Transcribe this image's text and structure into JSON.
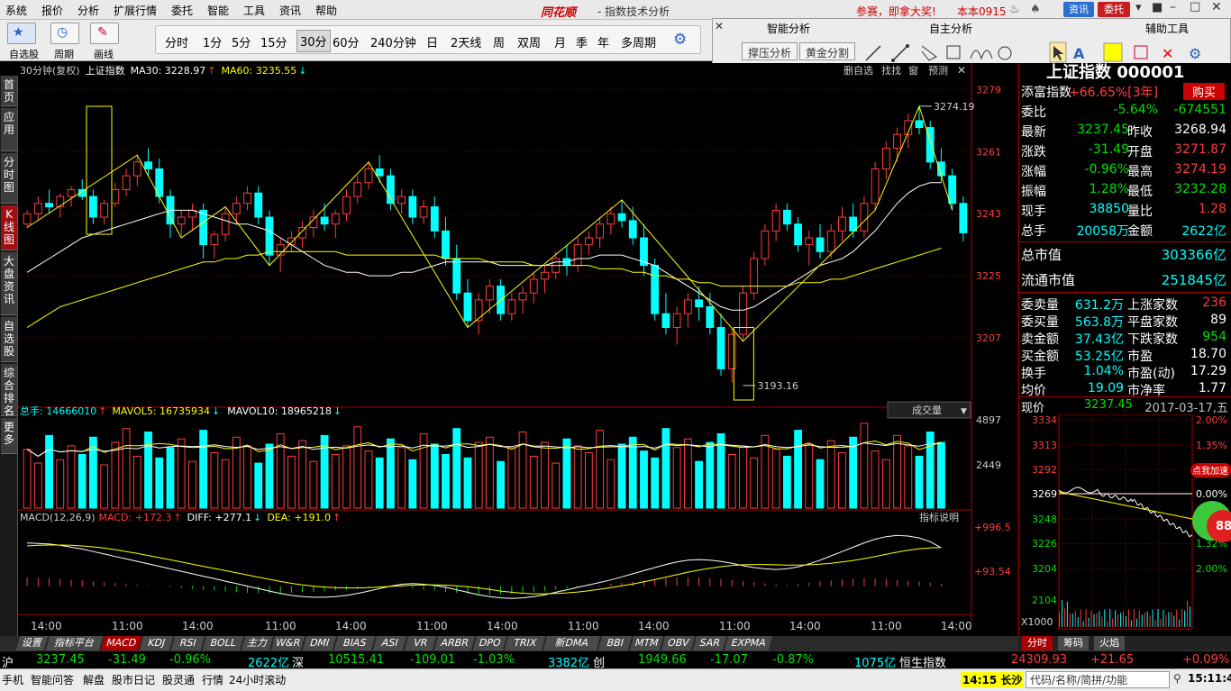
{
  "menu": [
    "系统",
    "报价",
    "分析",
    "扩展行情",
    "委托",
    "智能",
    "工具",
    "资讯",
    "帮助"
  ],
  "app": {
    "logo": "同花顺",
    "title": "- 指数技术分析",
    "promo": "参赛，即拿大奖!",
    "user": "本本0915",
    "btn_info": "资讯",
    "btn_trade": "委托"
  },
  "toolbar": {
    "labels": [
      "自选股",
      "周期",
      "画线"
    ]
  },
  "periods": [
    "分时",
    "1分",
    "5分",
    "15分",
    "30分",
    "60分",
    "240分钟",
    "日",
    "2天线",
    "周",
    "双周",
    "月",
    "季",
    "年",
    "多周期"
  ],
  "active_period": "30分",
  "panel": {
    "headers": [
      "智能分析",
      "自主分析",
      "辅助工具"
    ],
    "buttons": [
      "撑压分析",
      "黄金分割"
    ]
  },
  "left_tabs": [
    "首页",
    "应用",
    "分时图",
    "K线图",
    "大盘资讯",
    "自选股",
    "综合排名",
    "更多"
  ],
  "chart_header": {
    "period": "30分钟(复权)",
    "name": "上证指数",
    "ma30": "MA30: 3228.97",
    "ma60": "MA60: 3235.55"
  },
  "vol_header": {
    "total": "总手: 14666010",
    "mavol5": "MAVOL5: 16735934",
    "mavol10": "MAVOL10: 18965218",
    "dropdown": "成交量"
  },
  "macd_header": {
    "macd": "MACD(12,26,9)",
    "macd_val": "MACD: +172.3",
    "diff": "DIFF: +277.1",
    "dea": "DEA: +191.0",
    "help": "指标说明"
  },
  "chart_buttons": [
    "删自选",
    "找找",
    "窗",
    "预测"
  ],
  "annotations": {
    "high": "3274.19",
    "low": "3193.16"
  },
  "price_axis": [
    "3279",
    "3261",
    "3243",
    "3225",
    "3207"
  ],
  "vol_axis": [
    "4897",
    "2449"
  ],
  "macd_axis": [
    "+996.5",
    "+93.54"
  ],
  "time_axis": [
    "14:00",
    "11:00",
    "14:00",
    "11:00",
    "14:00",
    "11:00",
    "14:00",
    "11:00",
    "14:00",
    "11:00",
    "14:00",
    "11:00",
    "14:00"
  ],
  "chart_data": {
    "type": "candlestick",
    "price_range": [
      3190,
      3282
    ],
    "ohlc": [
      [
        3240,
        3244,
        3239,
        3243
      ],
      [
        3243,
        3248,
        3241,
        3246
      ],
      [
        3246,
        3250,
        3243,
        3245
      ],
      [
        3245,
        3249,
        3242,
        3248
      ],
      [
        3248,
        3251,
        3245,
        3250
      ],
      [
        3250,
        3253,
        3247,
        3248
      ],
      [
        3248,
        3250,
        3240,
        3242
      ],
      [
        3242,
        3247,
        3240,
        3246
      ],
      [
        3246,
        3252,
        3245,
        3250
      ],
      [
        3250,
        3256,
        3248,
        3254
      ],
      [
        3254,
        3260,
        3251,
        3258
      ],
      [
        3258,
        3262,
        3254,
        3256
      ],
      [
        3256,
        3259,
        3246,
        3248
      ],
      [
        3248,
        3250,
        3236,
        3240
      ],
      [
        3240,
        3244,
        3236,
        3242
      ],
      [
        3242,
        3246,
        3238,
        3244
      ],
      [
        3244,
        3246,
        3230,
        3234
      ],
      [
        3234,
        3238,
        3230,
        3237
      ],
      [
        3237,
        3245,
        3235,
        3243
      ],
      [
        3243,
        3248,
        3240,
        3246
      ],
      [
        3246,
        3251,
        3244,
        3249
      ],
      [
        3249,
        3251,
        3240,
        3242
      ],
      [
        3242,
        3244,
        3228,
        3231
      ],
      [
        3231,
        3236,
        3226,
        3234
      ],
      [
        3234,
        3238,
        3232,
        3236
      ],
      [
        3236,
        3241,
        3233,
        3239
      ],
      [
        3239,
        3244,
        3236,
        3242
      ],
      [
        3242,
        3246,
        3238,
        3240
      ],
      [
        3240,
        3244,
        3236,
        3243
      ],
      [
        3243,
        3250,
        3241,
        3248
      ],
      [
        3248,
        3254,
        3246,
        3252
      ],
      [
        3252,
        3258,
        3250,
        3256
      ],
      [
        3256,
        3260,
        3252,
        3254
      ],
      [
        3254,
        3256,
        3244,
        3246
      ],
      [
        3246,
        3250,
        3243,
        3248
      ],
      [
        3248,
        3250,
        3240,
        3242
      ],
      [
        3242,
        3247,
        3240,
        3245
      ],
      [
        3245,
        3248,
        3236,
        3238
      ],
      [
        3238,
        3242,
        3228,
        3230
      ],
      [
        3230,
        3234,
        3218,
        3220
      ],
      [
        3220,
        3224,
        3210,
        3212
      ],
      [
        3212,
        3220,
        3208,
        3218
      ],
      [
        3218,
        3224,
        3214,
        3222
      ],
      [
        3222,
        3224,
        3212,
        3214
      ],
      [
        3214,
        3220,
        3212,
        3218
      ],
      [
        3218,
        3222,
        3214,
        3220
      ],
      [
        3220,
        3226,
        3217,
        3224
      ],
      [
        3224,
        3228,
        3220,
        3226
      ],
      [
        3226,
        3232,
        3224,
        3230
      ],
      [
        3230,
        3234,
        3225,
        3228
      ],
      [
        3228,
        3236,
        3226,
        3234
      ],
      [
        3234,
        3238,
        3231,
        3236
      ],
      [
        3236,
        3242,
        3233,
        3240
      ],
      [
        3240,
        3245,
        3237,
        3243
      ],
      [
        3243,
        3247,
        3239,
        3241
      ],
      [
        3241,
        3245,
        3234,
        3236
      ],
      [
        3236,
        3240,
        3225,
        3228
      ],
      [
        3228,
        3230,
        3212,
        3214
      ],
      [
        3214,
        3220,
        3208,
        3210
      ],
      [
        3210,
        3216,
        3205,
        3214
      ],
      [
        3214,
        3220,
        3210,
        3218
      ],
      [
        3218,
        3222,
        3212,
        3216
      ],
      [
        3216,
        3220,
        3208,
        3210
      ],
      [
        3210,
        3214,
        3196,
        3198
      ],
      [
        3198,
        3210,
        3194,
        3208
      ],
      [
        3208,
        3222,
        3206,
        3220
      ],
      [
        3220,
        3232,
        3218,
        3230
      ],
      [
        3230,
        3240,
        3228,
        3238
      ],
      [
        3238,
        3246,
        3235,
        3244
      ],
      [
        3244,
        3246,
        3238,
        3240
      ],
      [
        3240,
        3242,
        3232,
        3234
      ],
      [
        3234,
        3238,
        3228,
        3236
      ],
      [
        3236,
        3240,
        3230,
        3232
      ],
      [
        3232,
        3240,
        3230,
        3238
      ],
      [
        3238,
        3245,
        3235,
        3242
      ],
      [
        3242,
        3246,
        3236,
        3238
      ],
      [
        3238,
        3248,
        3236,
        3246
      ],
      [
        3246,
        3258,
        3244,
        3256
      ],
      [
        3256,
        3264,
        3253,
        3262
      ],
      [
        3262,
        3268,
        3258,
        3266
      ],
      [
        3266,
        3272,
        3262,
        3270
      ],
      [
        3270,
        3274.19,
        3266,
        3268
      ],
      [
        3268,
        3270,
        3256,
        3258
      ],
      [
        3258,
        3262,
        3252,
        3254
      ],
      [
        3254,
        3256,
        3244,
        3246
      ],
      [
        3246,
        3248,
        3235,
        3237.45
      ]
    ],
    "ma30": [
      3226,
      3228,
      3230,
      3232,
      3234,
      3236,
      3237,
      3238,
      3239,
      3240,
      3241,
      3242,
      3243,
      3244,
      3244,
      3244,
      3243,
      3242,
      3241,
      3240,
      3240,
      3239,
      3238,
      3236,
      3234,
      3232,
      3230,
      3228,
      3227,
      3226,
      3226,
      3225,
      3225,
      3225,
      3226,
      3226,
      3227,
      3228,
      3229,
      3229,
      3229,
      3229,
      3229,
      3228,
      3228,
      3228,
      3228,
      3228,
      3229,
      3229,
      3230,
      3230,
      3231,
      3231,
      3231,
      3230,
      3229,
      3228,
      3226,
      3224,
      3222,
      3220,
      3218,
      3216,
      3215,
      3215,
      3216,
      3218,
      3220,
      3222,
      3224,
      3226,
      3228,
      3229,
      3230,
      3232,
      3235,
      3238,
      3242,
      3246,
      3249,
      3251,
      3252,
      3252
    ],
    "ma60": [
      3210,
      3212,
      3214,
      3216,
      3217,
      3218,
      3219,
      3220,
      3221,
      3222,
      3223,
      3224,
      3225,
      3226,
      3227,
      3228,
      3229,
      3229,
      3230,
      3230,
      3231,
      3231,
      3232,
      3232,
      3232,
      3232,
      3232,
      3232,
      3232,
      3231,
      3231,
      3231,
      3231,
      3231,
      3231,
      3231,
      3231,
      3231,
      3230,
      3230,
      3230,
      3230,
      3229,
      3229,
      3229,
      3229,
      3228,
      3228,
      3228,
      3228,
      3228,
      3228,
      3227,
      3227,
      3227,
      3226,
      3226,
      3225,
      3225,
      3224,
      3224,
      3223,
      3223,
      3222,
      3222,
      3222,
      3222,
      3222,
      3222,
      3222,
      3223,
      3223,
      3223,
      3224,
      3224,
      3225,
      3226,
      3227,
      3228,
      3229,
      3230,
      3231,
      3232,
      3233
    ],
    "volume": [
      3400,
      2600,
      4200,
      2800,
      3600,
      3100,
      4100,
      2500,
      3800,
      4600,
      3000,
      4400,
      2900,
      3500,
      4000,
      2700,
      4500,
      3200,
      2800,
      4100,
      3600,
      2600,
      3700,
      4300,
      3000,
      3900,
      2700,
      4200,
      3100,
      3600,
      4700,
      3300,
      2900,
      4000,
      3500,
      2800,
      4300,
      3700,
      3100,
      4600,
      2900,
      3800,
      4100,
      2700,
      3500,
      4400,
      3000,
      3800,
      2600,
      4000,
      3600,
      3200,
      4500,
      2800,
      3700,
      4100,
      3300,
      2900,
      4600,
      3500,
      4000,
      2700,
      3800,
      4300,
      3100,
      3600,
      2900,
      4200,
      3400,
      3000,
      4500,
      3700,
      2800,
      3900,
      3200,
      4100,
      4900,
      3300,
      2800,
      4200,
      3600,
      3000,
      4400,
      3800
    ],
    "macd_bars": [
      320,
      300,
      280,
      250,
      220,
      200,
      170,
      140,
      110,
      80,
      50,
      20,
      -10,
      -40,
      -70,
      -100,
      -130,
      -160,
      -190,
      -220,
      -240,
      -250,
      -255,
      -250,
      -240,
      -220,
      -200,
      -180,
      -150,
      -120,
      -90,
      -60,
      -30,
      -10,
      -40,
      -80,
      -120,
      -160,
      -200,
      -240,
      -270,
      -290,
      -300,
      -290,
      -270,
      -240,
      -200,
      -160,
      -120,
      -80,
      -40,
      0,
      40,
      80,
      120,
      160,
      200,
      240,
      280,
      300,
      310,
      300,
      280,
      250,
      220,
      180,
      140,
      100,
      60,
      40,
      80,
      120,
      160,
      200,
      240,
      260,
      280,
      270,
      250,
      220,
      190,
      160,
      120,
      80
    ],
    "diff": [
      700,
      690,
      680,
      660,
      630,
      600,
      560,
      520,
      480,
      440,
      400,
      360,
      320,
      280,
      240,
      200,
      160,
      120,
      80,
      40,
      0,
      -40,
      -80,
      -120,
      -150,
      -170,
      -180,
      -180,
      -170,
      -150,
      -120,
      -80,
      -40,
      0,
      30,
      40,
      30,
      10,
      -20,
      -60,
      -100,
      -140,
      -170,
      -190,
      -200,
      -190,
      -170,
      -140,
      -100,
      -60,
      -20,
      20,
      60,
      100,
      150,
      200,
      250,
      300,
      350,
      390,
      420,
      430,
      420,
      400,
      370,
      330,
      300,
      280,
      270,
      280,
      310,
      360,
      420,
      490,
      560,
      630,
      700,
      760,
      800,
      820,
      810,
      780,
      720,
      620
    ],
    "dea": [
      650,
      660,
      665,
      665,
      660,
      650,
      635,
      615,
      590,
      560,
      530,
      495,
      460,
      425,
      390,
      355,
      320,
      285,
      250,
      215,
      180,
      145,
      110,
      75,
      45,
      20,
      0,
      -15,
      -25,
      -30,
      -30,
      -25,
      -15,
      -5,
      5,
      15,
      20,
      20,
      15,
      5,
      -10,
      -30,
      -55,
      -80,
      -100,
      -115,
      -125,
      -125,
      -120,
      -110,
      -95,
      -75,
      -50,
      -25,
      5,
      35,
      70,
      105,
      145,
      185,
      225,
      260,
      290,
      315,
      335,
      345,
      350,
      350,
      345,
      340,
      340,
      345,
      355,
      370,
      390,
      415,
      445,
      480,
      515,
      550,
      580,
      605,
      620,
      625
    ],
    "low_marker_index": 65,
    "high_marker_index": 81
  },
  "quote": {
    "header": "上证指数 000001",
    "rows": [
      {
        "l": "添富指数",
        "v": "+66.65%[3年]",
        "r": "购买"
      },
      {
        "l": "委比",
        "v": "-5.64%",
        "r": "-674551"
      },
      {
        "l": "最新",
        "v": "3237.45",
        "l2": "昨收",
        "r": "3268.94"
      },
      {
        "l": "涨跌",
        "v": "-31.49",
        "l2": "开盘",
        "r": "3271.87"
      },
      {
        "l": "涨幅",
        "v": "-0.96%",
        "l2": "最高",
        "r": "3274.19"
      },
      {
        "l": "振幅",
        "v": "1.28%",
        "l2": "最低",
        "r": "3232.28"
      },
      {
        "l": "现手",
        "v": "38850",
        "l2": "量比",
        "r": "1.28"
      },
      {
        "l": "总手",
        "v": "20058万",
        "l2": "金额",
        "r": "2622亿"
      }
    ],
    "mktcap": {
      "l": "总市值",
      "v": "303366亿"
    },
    "floatcap": {
      "l": "流通市值",
      "v": "251845亿"
    },
    "rows2": [
      {
        "l": "委卖量",
        "v": "631.2万",
        "l2": "上涨家数",
        "r": "236"
      },
      {
        "l": "委买量",
        "v": "563.8万",
        "l2": "平盘家数",
        "r": "89"
      },
      {
        "l": "卖金额",
        "v": "37.43亿",
        "l2": "下跌家数",
        "r": "954"
      },
      {
        "l": "买金额",
        "v": "53.25亿",
        "l2": "市盈",
        "r": "18.70"
      },
      {
        "l": "换手",
        "v": "1.04%",
        "l2": "市盈(动)",
        "r": "17.29"
      },
      {
        "l": "均价",
        "v": "19.09",
        "l2": "市净率",
        "r": "1.77"
      }
    ],
    "now": {
      "l": "现价",
      "v": "3237.45",
      "d": "2017-03-17,五"
    },
    "mini_axis_left": [
      "3334",
      "3313",
      "3292",
      "3269",
      "3248",
      "3226",
      "3204",
      "2104"
    ],
    "mini_axis_right": [
      "2.00%",
      "1.35%",
      "0.67%",
      "0.00%",
      "0.64%",
      "1.32%",
      "2.00%"
    ],
    "mini_x": "X1000",
    "badge": "点我加速",
    "badge_num": "88"
  },
  "indicators": [
    "设置",
    "指标平台",
    "MACD",
    "KDJ",
    "RSI",
    "BOLL",
    "主力",
    "W&R",
    "DMI",
    "BIAS",
    "ASI",
    "VR",
    "ARBR",
    "DPO",
    "TRIX",
    "新DMA",
    "BBI",
    "MTM",
    "OBV",
    "SAR",
    "EXPMA"
  ],
  "active_indicator": "MACD",
  "right_tabs": [
    "分时",
    "筹码",
    "火焰"
  ],
  "ticker": {
    "sh": "沪",
    "sh_val": "3237.45",
    "sh_chg": "-31.49",
    "sh_pct": "-0.96%",
    "sh_amt": "2622亿",
    "sz": "深",
    "sz_val": "10515.41",
    "sz_chg": "-109.01",
    "sz_pct": "-1.03%",
    "sz_amt": "3382亿",
    "cy": "创",
    "cy_val": "1949.66",
    "cy_chg": "-17.07",
    "cy_pct": "-0.87%",
    "cy_amt": "1075亿",
    "hs": "恒生指数",
    "hs_val": "24309.93",
    "hs_chg": "+21.65",
    "hs_pct": "+0.09%"
  },
  "status": {
    "items": [
      "手机",
      "智能问答",
      "解盘",
      "股市日记",
      "股灵通",
      "行情",
      "24小时滚动"
    ],
    "alert": "14:15 长沙",
    "search": "代码/名称/简拼/功能",
    "clock": "15:11:45"
  }
}
